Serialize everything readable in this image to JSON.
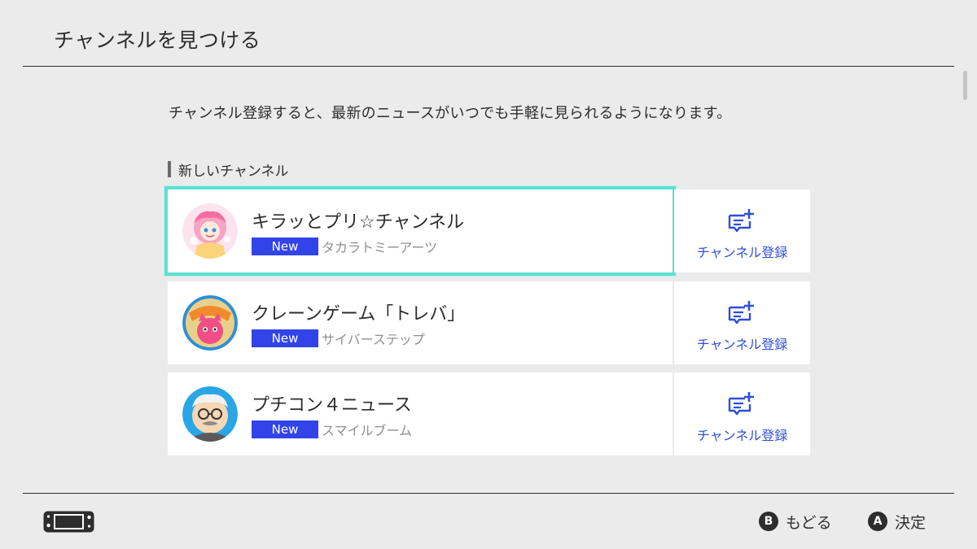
{
  "header": {
    "title": "チャンネルを見つける"
  },
  "intro": "チャンネル登録すると、最新のニュースがいつでも手軽に見られるようになります。",
  "section": {
    "label": "新しいチャンネル"
  },
  "channels": [
    {
      "name": "キラッとプリ☆チャンネル",
      "badge": "New",
      "publisher": "タカラトミーアーツ",
      "subscribe_label": "チャンネル登録",
      "selected": true
    },
    {
      "name": "クレーンゲーム「トレバ」",
      "badge": "New",
      "publisher": "サイバーステップ",
      "subscribe_label": "チャンネル登録",
      "selected": false
    },
    {
      "name": "プチコン４ニュース",
      "badge": "New",
      "publisher": "スマイルブーム",
      "subscribe_label": "チャンネル登録",
      "selected": false
    }
  ],
  "footer": {
    "back": {
      "key": "B",
      "label": "もどる"
    },
    "confirm": {
      "key": "A",
      "label": "決定"
    }
  },
  "colors": {
    "background": "#ebebeb",
    "selection": "#5fe0d2",
    "badge": "#3244e8",
    "accent": "#2f4fd8",
    "text": "#2d2d2d",
    "muted_text": "#8f8f8f"
  },
  "icons": {
    "subscribe": "add-channel-icon",
    "device": "handheld-console-icon"
  }
}
